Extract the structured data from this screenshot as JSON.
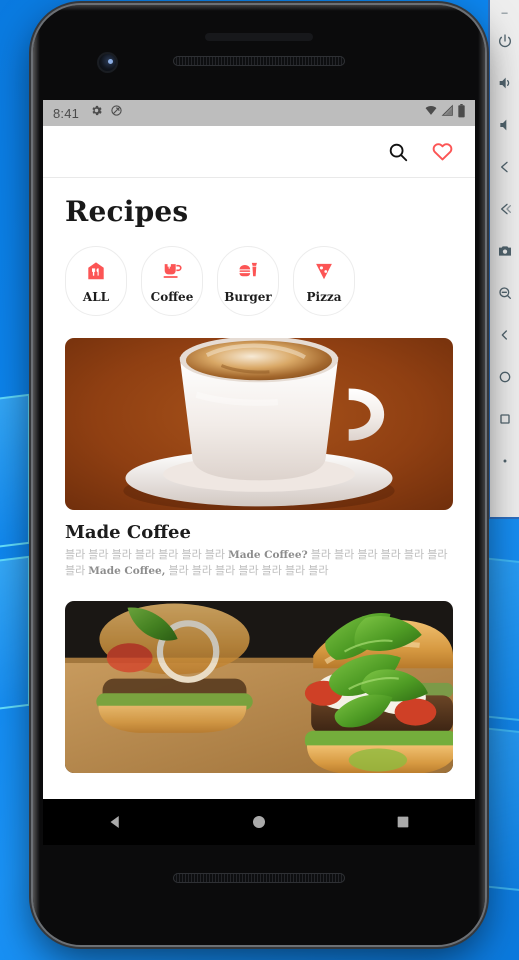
{
  "desktop": {
    "wallpaper_name": "windows-10-wallpaper",
    "background_color": "#0d86ef",
    "pane_accent_color": "#6eebff"
  },
  "side_panel": {
    "name": "emulator-tool-panel",
    "background_color": "#eeeeee",
    "icon_color": "#51646e",
    "minimize_label": "–",
    "items": [
      {
        "icon": "power-icon"
      },
      {
        "icon": "volume-up-icon"
      },
      {
        "icon": "volume-down-icon"
      },
      {
        "icon": "rotate-left-icon"
      },
      {
        "icon": "rotate-right-icon"
      },
      {
        "icon": "camera-icon"
      },
      {
        "icon": "zoom-out-icon"
      },
      {
        "icon": "back-arrow-icon"
      },
      {
        "icon": "home-circle-icon"
      },
      {
        "icon": "overview-square-icon"
      },
      {
        "icon": "more-dots-icon"
      }
    ]
  },
  "phone": {
    "device_name": "android-emulator-phone",
    "earpiece": "earpiece-speaker",
    "front_camera": "front-camera",
    "top_grille": "top-speaker-grille",
    "bottom_grille": "bottom-speaker-grille"
  },
  "status_bar": {
    "time": "8:41",
    "background_color": "#bdbdbd",
    "left_icons": [
      "gear-icon",
      "sync-disabled-icon"
    ],
    "right_icons": [
      "wifi-icon",
      "cellular-signal-icon",
      "battery-icon"
    ]
  },
  "app_bar": {
    "search_icon": "search-icon",
    "favorite_icon": "heart-icon",
    "favorite_color": "#fc5555"
  },
  "page": {
    "title": "Recipes"
  },
  "categories": {
    "accent_color": "#fc5555",
    "items": [
      {
        "label": "ALL",
        "icon": "restaurant-house-icon"
      },
      {
        "label": "Coffee",
        "icon": "coffee-cup-icon"
      },
      {
        "label": "Burger",
        "icon": "burger-drink-icon"
      },
      {
        "label": "Pizza",
        "icon": "pizza-slice-icon"
      }
    ]
  },
  "recipes": [
    {
      "title": "Made Coffee",
      "image": "cappuccino-cup-photo",
      "desc_part1": "블라 블라 블라 블라 블라 블라 블라 ",
      "desc_bold1": "Made Coffee?",
      "desc_part2": " 블라 블라 블라 블라 블라 블라 블라 ",
      "desc_bold2": "Made Coffee,",
      "desc_part3": " 블라 블라 블라 블라 블라 블라 블라"
    },
    {
      "title": "",
      "image": "burger-basil-photo",
      "desc_part1": "",
      "desc_bold1": "",
      "desc_part2": "",
      "desc_bold2": "",
      "desc_part3": ""
    }
  ],
  "nav_bar": {
    "back": "back-triangle-icon",
    "home": "home-circle-icon",
    "recents": "recents-square-icon",
    "icon_color": "#aaaaaa"
  }
}
